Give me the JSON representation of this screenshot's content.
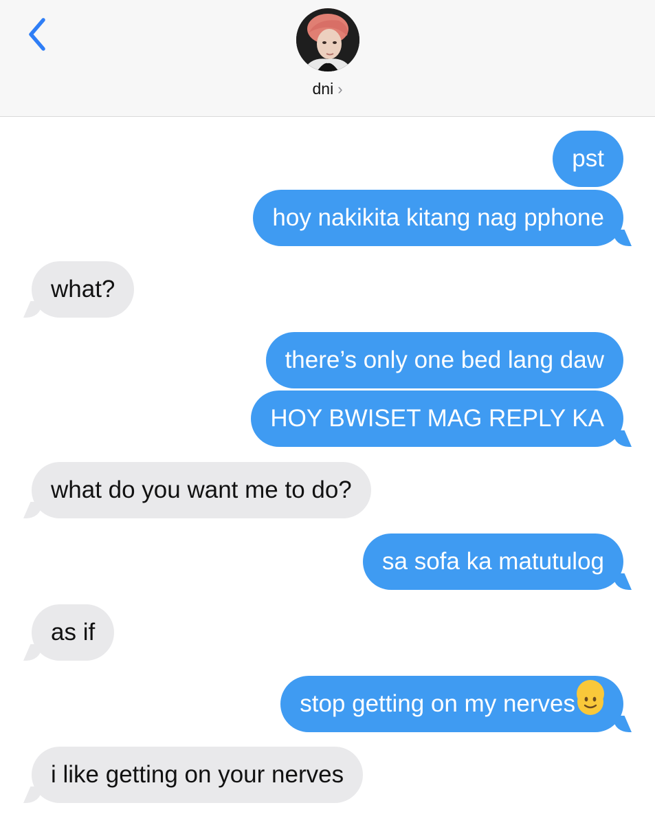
{
  "header": {
    "contact_name": "dni",
    "chevron": "›"
  },
  "messages": [
    {
      "from": "me",
      "text": "pst"
    },
    {
      "from": "me",
      "text": "hoy nakikita kitang nag pphone"
    },
    {
      "from": "them",
      "text": "what?"
    },
    {
      "from": "me",
      "text": "there’s only one bed lang daw"
    },
    {
      "from": "me",
      "text": "HOY BWISET MAG REPLY KA"
    },
    {
      "from": "them",
      "text": "what do you want me to do?"
    },
    {
      "from": "me",
      "text": "sa sofa ka matutulog"
    },
    {
      "from": "them",
      "text": "as if"
    },
    {
      "from": "me",
      "text": "stop getting on my nerves",
      "emoji": "slightly-smiling-face"
    },
    {
      "from": "them",
      "text": "i like getting on your nerves"
    }
  ],
  "colors": {
    "sent_bubble": "#3f9bf2",
    "received_bubble": "#e9e9eb",
    "back_arrow": "#2f7ef6"
  },
  "icons": [
    "back-chevron-icon",
    "contact-chevron-icon",
    "slightly-smiling-face-emoji"
  ]
}
